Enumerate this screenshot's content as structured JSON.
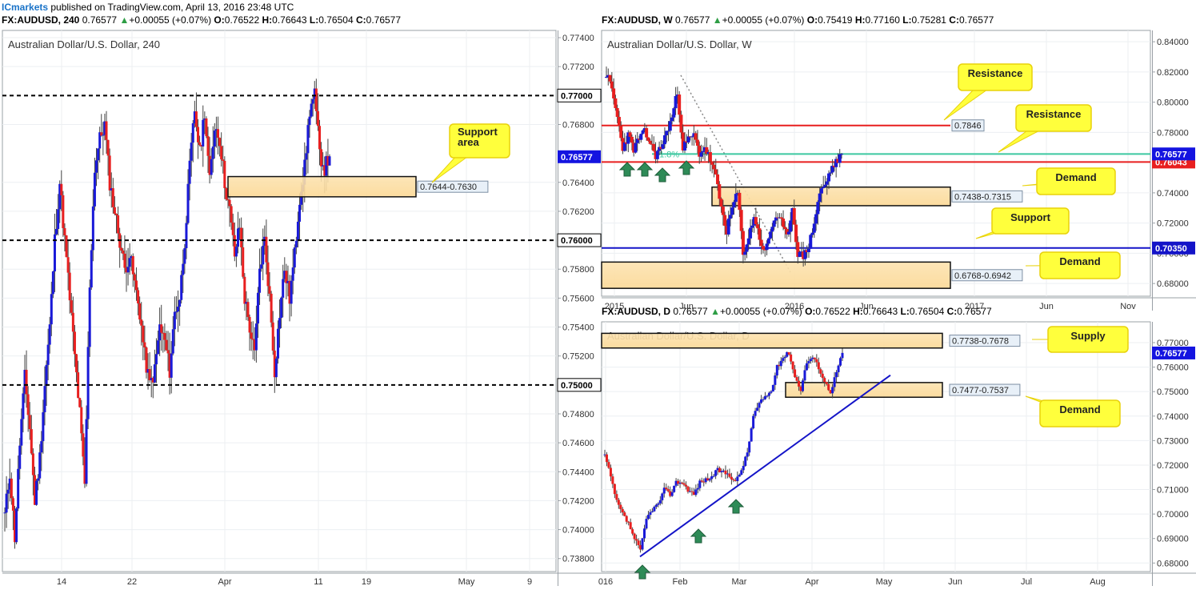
{
  "publisher": {
    "brand": "ICmarkets",
    "text": " published on TradingView.com, April 13, 2016 23:48 UTC"
  },
  "panels": [
    {
      "id": "h4",
      "header": {
        "symbol": "FX:AUDUSD, 240",
        "last": "0.76577",
        "change": "+0.00055 (+0.07%)",
        "o": "0.76522",
        "h": "0.76643",
        "l": "0.76504",
        "c": "0.76577"
      },
      "title": "Australian Dollar/U.S. Dollar, 240",
      "price_range": [
        0.7371,
        0.7745
      ],
      "ticks": [
        "0.77400",
        "0.77200",
        "0.76800",
        "0.76400",
        "0.76200",
        "0.75800",
        "0.75600",
        "0.75400",
        "0.75200",
        "0.74800",
        "0.74600",
        "0.74400",
        "0.74200",
        "0.74000",
        "0.73800"
      ],
      "xticks": [
        "14",
        "22",
        "Apr",
        "11",
        "19",
        "May",
        "9"
      ],
      "levels": [
        {
          "price": 0.77,
          "label": "0.77000",
          "style": "dashed",
          "color": "#000000"
        },
        {
          "price": 0.76,
          "label": "0.76000",
          "style": "dashed",
          "color": "#000000"
        },
        {
          "price": 0.75,
          "label": "0.75000",
          "style": "dashed",
          "color": "#000000"
        }
      ],
      "last_price": {
        "price": 0.76577,
        "label": "0.76577",
        "color": "#1414e0"
      },
      "zones": [
        {
          "top": 0.7644,
          "bottom": 0.763,
          "label": "0.7644-0.7630"
        }
      ],
      "annotations": [
        {
          "text": [
            "Support",
            "area"
          ]
        }
      ]
    },
    {
      "id": "w",
      "header": {
        "symbol": "FX:AUDUSD, W",
        "last": "0.76577",
        "change": "+0.00055 (+0.07%)",
        "o": "0.75419",
        "h": "0.77160",
        "l": "0.75281",
        "c": "0.76577"
      },
      "title": "Australian Dollar/U.S. Dollar, W",
      "price_range": [
        0.6716,
        0.8475
      ],
      "ticks": [
        "0.84000",
        "0.82000",
        "0.80000",
        "0.78000",
        "0.74000",
        "0.72000",
        "0.70000",
        "0.68000"
      ],
      "xticks": [
        "2015",
        "Jun",
        "2016",
        "Jun",
        "2017",
        "Jun",
        "Nov"
      ],
      "levels": [
        {
          "price": 0.7846,
          "label": "0.7846",
          "style": "solid",
          "color": "#e81f1f"
        },
        {
          "price": 0.7604,
          "label": "0.76043",
          "style": "solid",
          "color": "#e81f1f"
        },
        {
          "price": 0.7035,
          "label": "0.70350",
          "style": "solid",
          "color": "#1414c8"
        }
      ],
      "fib": {
        "price": 0.7657,
        "label": "61.8%"
      },
      "last_price": {
        "price": 0.76577,
        "label": "0.76577",
        "color": "#1414e0"
      },
      "zones": [
        {
          "top": 0.7438,
          "bottom": 0.7315,
          "label": "0.7438-0.7315"
        },
        {
          "top": 0.6942,
          "bottom": 0.6768,
          "label": "0.6768-0.6942"
        }
      ],
      "annotations": [
        {
          "text": [
            "Resistance"
          ]
        },
        {
          "text": [
            "Resistance"
          ]
        },
        {
          "text": [
            "Demand"
          ]
        },
        {
          "text": [
            "Support"
          ]
        },
        {
          "text": [
            "Demand"
          ]
        }
      ]
    },
    {
      "id": "d",
      "header": {
        "symbol": "FX:AUDUSD, D",
        "last": "0.76577",
        "change": "+0.00055 (+0.07%)",
        "o": "0.76522",
        "h": "0.76643",
        "l": "0.76504",
        "c": "0.76577"
      },
      "title": "Australian Dollar/U.S. Dollar, D",
      "price_range": [
        0.6765,
        0.7785
      ],
      "ticks": [
        "0.77000",
        "0.76000",
        "0.75000",
        "0.74000",
        "0.73000",
        "0.72000",
        "0.71000",
        "0.70000",
        "0.69000",
        "0.68000"
      ],
      "xticks": [
        "016",
        "Feb",
        "Mar",
        "Apr",
        "May",
        "Jun",
        "Jul",
        "Aug"
      ],
      "last_price": {
        "price": 0.76577,
        "label": "0.76577",
        "color": "#1414e0"
      },
      "zones": [
        {
          "top": 0.7738,
          "bottom": 0.7678,
          "label": "0.7738-0.7678"
        },
        {
          "top": 0.7537,
          "bottom": 0.7477,
          "label": "0.7477-0.7537"
        }
      ],
      "trendline": {
        "from": [
          "Jan 21",
          0.6826
        ],
        "to": [
          "Apr 26",
          0.7567
        ]
      },
      "annotations": [
        {
          "text": [
            "Supply"
          ]
        },
        {
          "text": [
            "Demand"
          ]
        }
      ]
    }
  ],
  "chart_data": [
    {
      "type": "candlestick",
      "title": "Australian Dollar/U.S. Dollar, 240",
      "timeframe": "240",
      "ylim": [
        0.7371,
        0.7745
      ],
      "grid": true,
      "ohlc_path": [
        0.741,
        0.744,
        0.7395,
        0.746,
        0.7505,
        0.747,
        0.742,
        0.745,
        0.75,
        0.754,
        0.76,
        0.764,
        0.76,
        0.756,
        0.752,
        0.748,
        0.743,
        0.757,
        0.765,
        0.767,
        0.768,
        0.764,
        0.762,
        0.76,
        0.758,
        0.759,
        0.757,
        0.755,
        0.752,
        0.75,
        0.751,
        0.754,
        0.753,
        0.751,
        0.755,
        0.756,
        0.76,
        0.765,
        0.769,
        0.766,
        0.769,
        0.764,
        0.768,
        0.767,
        0.764,
        0.762,
        0.759,
        0.761,
        0.756,
        0.754,
        0.752,
        0.758,
        0.76,
        0.756,
        0.751,
        0.755,
        0.758,
        0.756,
        0.759,
        0.763,
        0.765,
        0.769,
        0.77,
        0.766,
        0.765,
        0.7658
      ],
      "levels": [
        0.77,
        0.76,
        0.75
      ],
      "zone": [
        0.7644,
        0.763
      ],
      "last": 0.76577
    },
    {
      "type": "candlestick",
      "title": "Australian Dollar/U.S. Dollar, W",
      "timeframe": "W",
      "ylim": [
        0.6716,
        0.8475
      ],
      "grid": true,
      "ohlc_path": [
        0.819,
        0.808,
        0.79,
        0.77,
        0.778,
        0.769,
        0.776,
        0.78,
        0.773,
        0.765,
        0.77,
        0.78,
        0.79,
        0.807,
        0.77,
        0.775,
        0.778,
        0.766,
        0.77,
        0.762,
        0.75,
        0.73,
        0.715,
        0.73,
        0.74,
        0.7,
        0.71,
        0.725,
        0.71,
        0.7,
        0.715,
        0.725,
        0.72,
        0.71,
        0.73,
        0.7,
        0.698,
        0.705,
        0.72,
        0.74,
        0.745,
        0.755,
        0.76,
        0.7658
      ],
      "levels": [
        0.7846,
        0.7604,
        0.7035
      ],
      "fib_618": 0.7657,
      "zones": [
        [
          0.7438,
          0.7315
        ],
        [
          0.6942,
          0.6768
        ]
      ],
      "last": 0.76577
    },
    {
      "type": "candlestick",
      "title": "Australian Dollar/U.S. Dollar, D",
      "timeframe": "D",
      "ylim": [
        0.6765,
        0.7785
      ],
      "grid": true,
      "ohlc_path": [
        0.724,
        0.715,
        0.705,
        0.7,
        0.696,
        0.69,
        0.685,
        0.698,
        0.702,
        0.704,
        0.71,
        0.708,
        0.713,
        0.713,
        0.71,
        0.708,
        0.713,
        0.714,
        0.715,
        0.718,
        0.717,
        0.716,
        0.713,
        0.718,
        0.725,
        0.74,
        0.745,
        0.748,
        0.75,
        0.76,
        0.764,
        0.766,
        0.756,
        0.751,
        0.762,
        0.764,
        0.76,
        0.754,
        0.75,
        0.758,
        0.7658
      ],
      "zones": [
        [
          0.7738,
          0.7678
        ],
        [
          0.7537,
          0.7477
        ]
      ],
      "last": 0.76577
    }
  ]
}
